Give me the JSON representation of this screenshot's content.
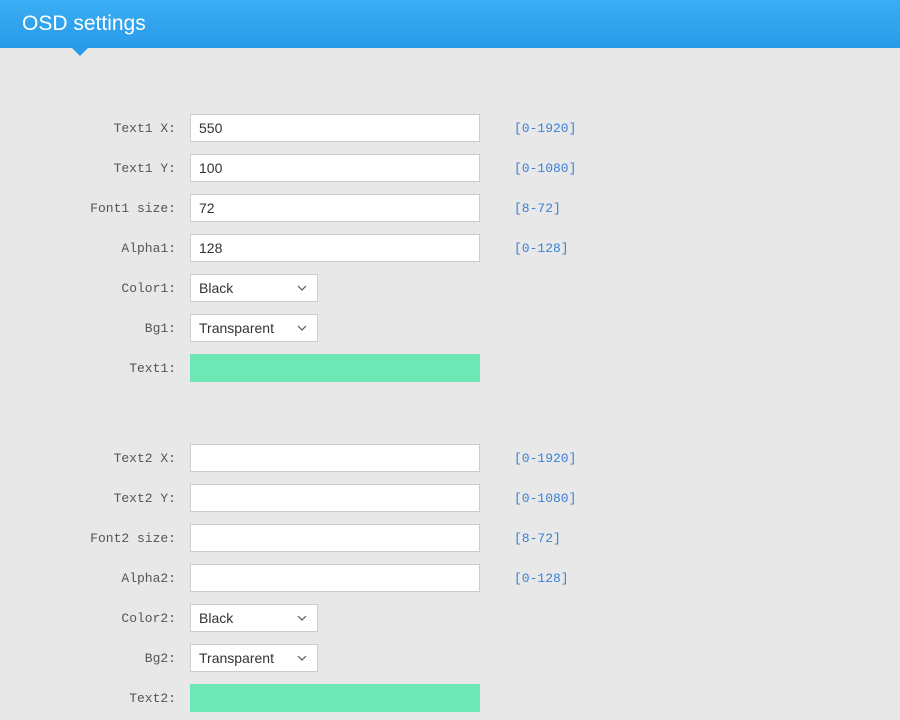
{
  "header": {
    "title": "OSD settings"
  },
  "group1": {
    "text_x": {
      "label": "Text1 X:",
      "value": "550",
      "hint": "[0-1920]"
    },
    "text_y": {
      "label": "Text1 Y:",
      "value": "100",
      "hint": "[0-1080]"
    },
    "font_size": {
      "label": "Font1 size:",
      "value": "72",
      "hint": "[8-72]"
    },
    "alpha": {
      "label": "Alpha1:",
      "value": "128",
      "hint": "[0-128]"
    },
    "color": {
      "label": "Color1:",
      "value": "Black"
    },
    "bg": {
      "label": "Bg1:",
      "value": "Transparent"
    },
    "text": {
      "label": "Text1:",
      "swatch": "#6ee7b7"
    }
  },
  "group2": {
    "text_x": {
      "label": "Text2 X:",
      "value": "",
      "hint": "[0-1920]"
    },
    "text_y": {
      "label": "Text2 Y:",
      "value": "",
      "hint": "[0-1080]"
    },
    "font_size": {
      "label": "Font2 size:",
      "value": "",
      "hint": "[8-72]"
    },
    "alpha": {
      "label": "Alpha2:",
      "value": "",
      "hint": "[0-128]"
    },
    "color": {
      "label": "Color2:",
      "value": "Black"
    },
    "bg": {
      "label": "Bg2:",
      "value": "Transparent"
    },
    "text": {
      "label": "Text2:",
      "swatch": "#6ee7b7"
    }
  }
}
